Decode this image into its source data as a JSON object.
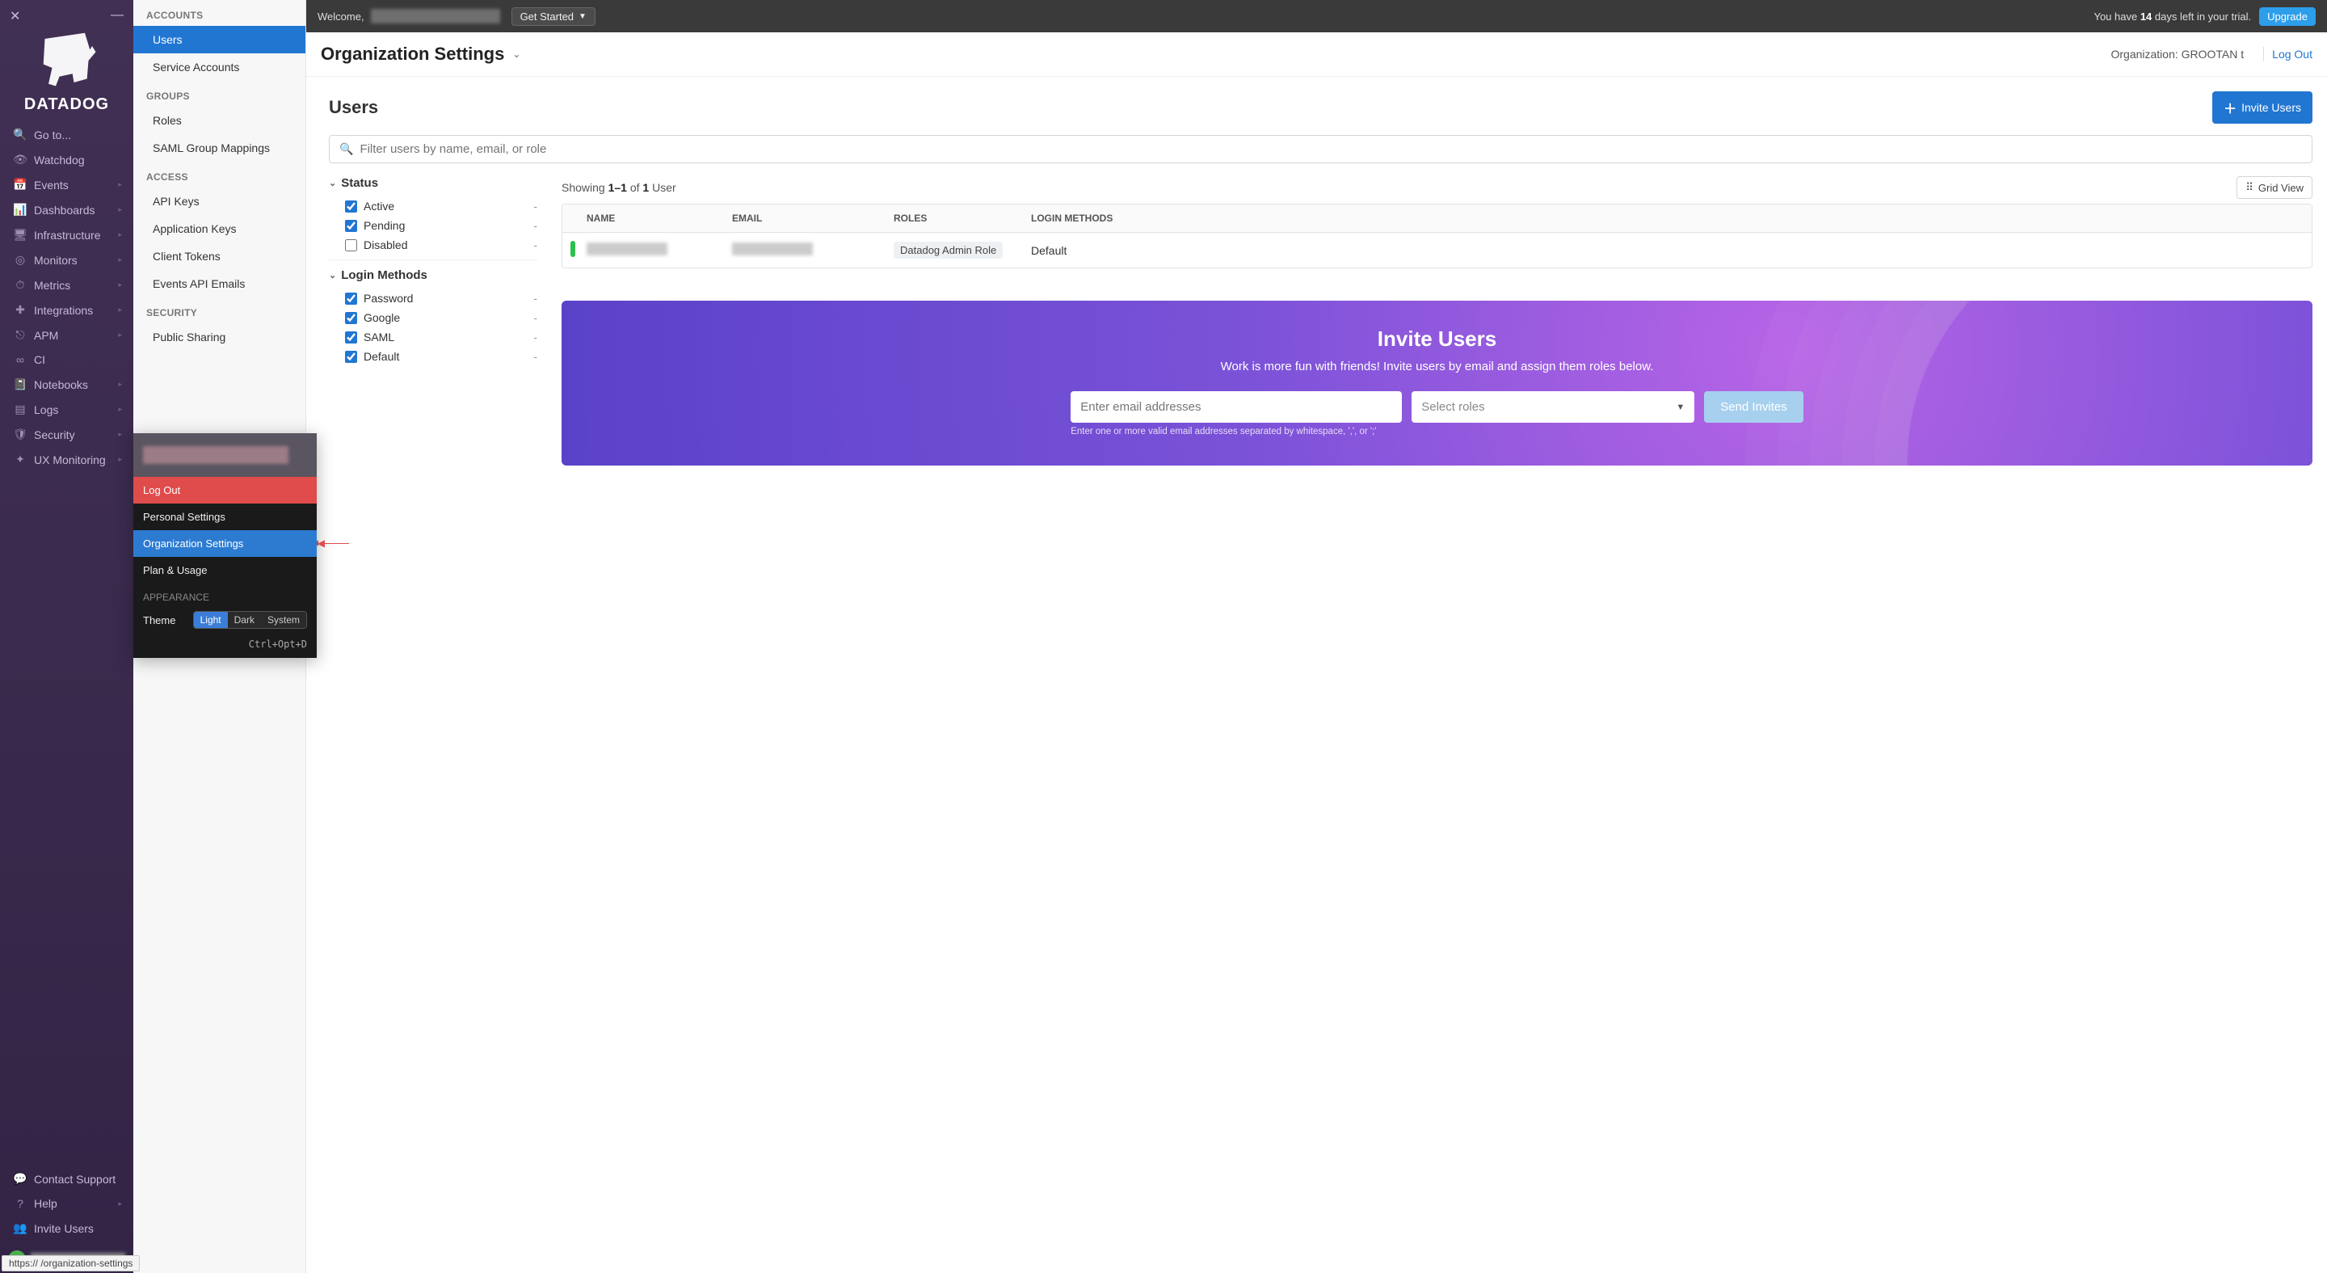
{
  "brand": "DATADOG",
  "topbar": {
    "welcome": "Welcome,",
    "get_started": "Get Started",
    "trial_prefix": "You have ",
    "trial_days": "14",
    "trial_suffix": " days left in your trial.",
    "upgrade": "Upgrade"
  },
  "left_nav": [
    {
      "icon": "🔍",
      "label": "Go to..."
    },
    {
      "icon": "👁",
      "label": "Watchdog"
    },
    {
      "icon": "📅",
      "label": "Events",
      "caret": true
    },
    {
      "icon": "📊",
      "label": "Dashboards",
      "caret": true
    },
    {
      "icon": "🖥",
      "label": "Infrastructure",
      "caret": true
    },
    {
      "icon": "◎",
      "label": "Monitors",
      "caret": true
    },
    {
      "icon": "⏱",
      "label": "Metrics",
      "caret": true
    },
    {
      "icon": "✚",
      "label": "Integrations",
      "caret": true
    },
    {
      "icon": "⎋",
      "label": "APM",
      "caret": true
    },
    {
      "icon": "∞",
      "label": "CI"
    },
    {
      "icon": "📓",
      "label": "Notebooks",
      "caret": true
    },
    {
      "icon": "▤",
      "label": "Logs",
      "caret": true
    },
    {
      "icon": "🛡",
      "label": "Security",
      "caret": true
    },
    {
      "icon": "✦",
      "label": "UX Monitoring",
      "caret": true
    }
  ],
  "left_nav_bottom": [
    {
      "icon": "💬",
      "label": "Contact Support"
    },
    {
      "icon": "?",
      "label": "Help",
      "caret": true
    },
    {
      "icon": "👥",
      "label": "Invite Users"
    }
  ],
  "sub_nav": {
    "sections": [
      {
        "label": "ACCOUNTS",
        "items": [
          {
            "label": "Users",
            "active": true
          },
          {
            "label": "Service Accounts"
          }
        ]
      },
      {
        "label": "GROUPS",
        "items": [
          {
            "label": "Roles"
          },
          {
            "label": "SAML Group Mappings"
          }
        ]
      },
      {
        "label": "ACCESS",
        "items": [
          {
            "label": "API Keys"
          },
          {
            "label": "Application Keys"
          },
          {
            "label": "Client Tokens"
          },
          {
            "label": "Events API Emails"
          }
        ]
      },
      {
        "label": "SECURITY",
        "items": [
          {
            "label": "Public Sharing"
          }
        ]
      }
    ]
  },
  "account_menu": {
    "logout": "Log Out",
    "personal": "Personal Settings",
    "org": "Organization Settings",
    "plan": "Plan & Usage",
    "appearance": "APPEARANCE",
    "theme_label": "Theme",
    "theme_opts": [
      "Light",
      "Dark",
      "System"
    ],
    "shortcut": "Ctrl+Opt+D"
  },
  "page": {
    "title": "Organization Settings",
    "org_label": "Organization: GROOTAN t",
    "logout": "Log Out"
  },
  "users": {
    "title": "Users",
    "invite_btn": "Invite Users",
    "search_placeholder": "Filter users by name, email, or role",
    "filters": {
      "status": {
        "head": "Status",
        "opts": [
          {
            "label": "Active",
            "checked": true,
            "count": "-"
          },
          {
            "label": "Pending",
            "checked": true,
            "count": "-"
          },
          {
            "label": "Disabled",
            "checked": false,
            "count": "-"
          }
        ]
      },
      "login": {
        "head": "Login Methods",
        "opts": [
          {
            "label": "Password",
            "checked": true,
            "count": "-"
          },
          {
            "label": "Google",
            "checked": true,
            "count": "-"
          },
          {
            "label": "SAML",
            "checked": true,
            "count": "-"
          },
          {
            "label": "Default",
            "checked": true,
            "count": "-"
          }
        ]
      }
    },
    "showing": {
      "pre": "Showing ",
      "range": "1–1",
      "of": " of ",
      "total": "1",
      "post": " User"
    },
    "grid_view": "Grid View",
    "table": {
      "headers": [
        "NAME",
        "EMAIL",
        "ROLES",
        "LOGIN METHODS"
      ],
      "rows": [
        {
          "role": "Datadog Admin Role",
          "login": "Default"
        }
      ]
    }
  },
  "invite_panel": {
    "title": "Invite Users",
    "sub": "Work is more fun with friends! Invite users by email and assign them roles below.",
    "email_placeholder": "Enter email addresses",
    "hint": "Enter one or more valid email addresses separated by whitespace, ',', or ';'",
    "roles_placeholder": "Select roles",
    "send": "Send Invites"
  },
  "url_hint": "https://                                 /organization-settings"
}
